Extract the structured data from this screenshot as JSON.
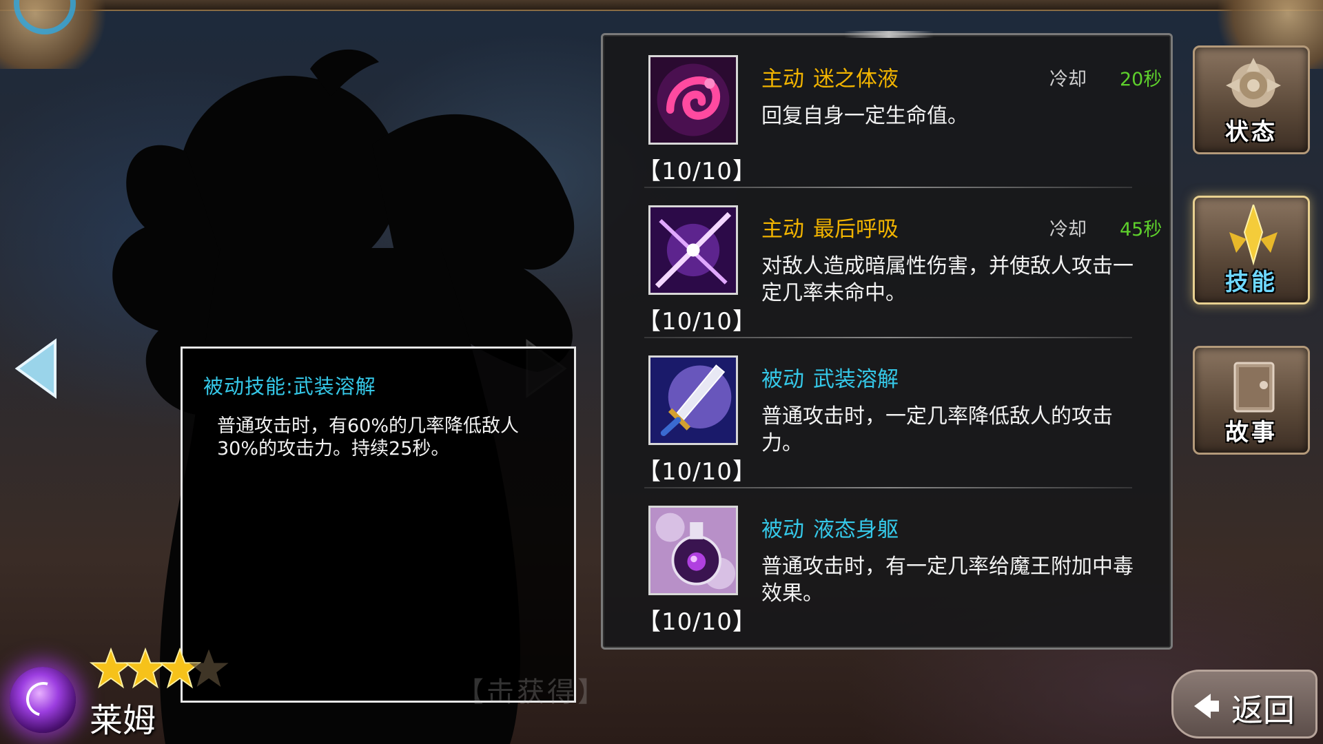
{
  "colors": {
    "active_skill": "#f2b400",
    "passive_skill": "#35c8e8",
    "cooldown_value": "#5ed02c",
    "selected_tab": "#6fd8ff"
  },
  "nav": {
    "left_arrow_icon": "triangle-left-icon",
    "right_arrow_icon": "triangle-right-icon"
  },
  "detail": {
    "title": "被动技能:武装溶解",
    "description": "普通攻击时，有60%的几率降低敌人30%的攻击力。持续25秒。"
  },
  "acquire_text": "【击获得】",
  "character": {
    "name": "莱姆",
    "element_icon": "moon-orb-icon",
    "stars_filled": 3,
    "stars_total": 4
  },
  "skills": [
    {
      "type": "主动",
      "type_kind": "active",
      "name": "迷之体液",
      "cooldown_label": "冷却",
      "cooldown_value": "20秒",
      "description": "回复自身一定生命值。",
      "level": "【10/10】",
      "icon": "slime-swirl-icon"
    },
    {
      "type": "主动",
      "type_kind": "active",
      "name": "最后呼吸",
      "cooldown_label": "冷却",
      "cooldown_value": "45秒",
      "description": "对敌人造成暗属性伤害，并使敌人攻击一定几率未命中。",
      "level": "【10/10】",
      "icon": "dark-slash-icon"
    },
    {
      "type": "被动",
      "type_kind": "passive",
      "name": "武装溶解",
      "description": "普通攻击时，一定几率降低敌人的攻击力。",
      "level": "【10/10】",
      "icon": "sword-dissolve-icon"
    },
    {
      "type": "被动",
      "type_kind": "passive",
      "name": "液态身躯",
      "description": "普通攻击时，有一定几率给魔王附加中毒效果。",
      "level": "【10/10】",
      "icon": "poison-flask-icon"
    }
  ],
  "tabs": [
    {
      "label": "状态",
      "icon": "rose-emblem-icon",
      "selected": false
    },
    {
      "label": "技能",
      "icon": "crown-emblem-icon",
      "selected": true
    },
    {
      "label": "故事",
      "icon": "book-emblem-icon",
      "selected": false
    }
  ],
  "back_button": {
    "label": "返回",
    "icon": "back-arrow-icon"
  }
}
